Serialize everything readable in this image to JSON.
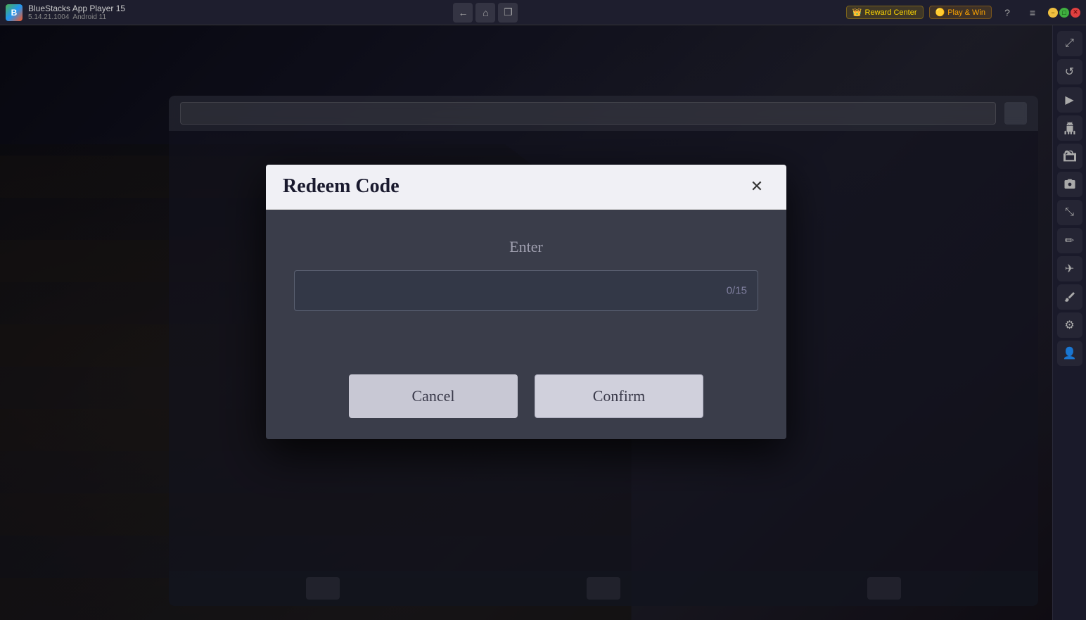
{
  "app": {
    "name": "BlueStacks App Player 15",
    "version": "5.14.21.1004",
    "android": "Android 11"
  },
  "titlebar": {
    "reward_center": "Reward Center",
    "play_win": "Play & Win",
    "nav_back": "←",
    "nav_home": "⌂",
    "nav_copy": "❐",
    "help": "?",
    "menu": "≡",
    "minimize": "−",
    "maximize": "□",
    "close": "✕",
    "expand": "⤢"
  },
  "sidebar": {
    "icons": [
      {
        "name": "expand-icon",
        "glyph": "⤢"
      },
      {
        "name": "refresh-icon",
        "glyph": "↺"
      },
      {
        "name": "play-icon",
        "glyph": "▶"
      },
      {
        "name": "android-icon",
        "glyph": "🤖"
      },
      {
        "name": "apk-icon",
        "glyph": "📦"
      },
      {
        "name": "camera-icon",
        "glyph": "📷"
      },
      {
        "name": "resize-icon",
        "glyph": "⤡"
      },
      {
        "name": "edit-icon",
        "glyph": "✏"
      },
      {
        "name": "flight-icon",
        "glyph": "✈"
      },
      {
        "name": "brush-icon",
        "glyph": "🖌"
      },
      {
        "name": "settings-icon",
        "glyph": "⚙"
      },
      {
        "name": "user-icon",
        "glyph": "👤"
      }
    ]
  },
  "modal": {
    "title": "Redeem Code",
    "close_label": "✕",
    "enter_label": "Enter",
    "input_placeholder": "",
    "input_counter": "0/15",
    "cancel_label": "Cancel",
    "confirm_label": "Confirm"
  }
}
